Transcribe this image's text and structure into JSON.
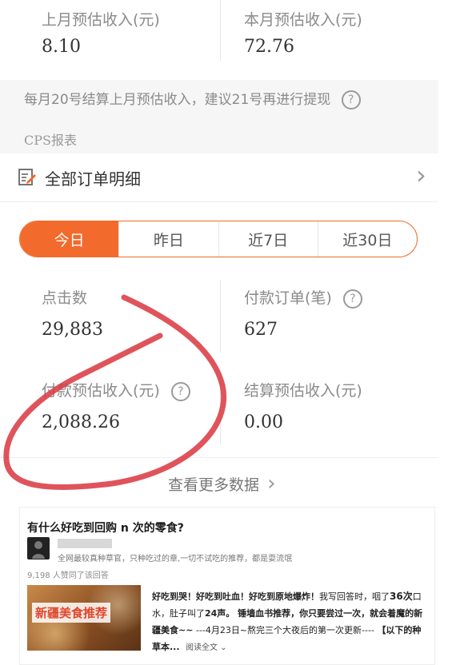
{
  "summary": {
    "last_month_label": "上月预估收入(元)",
    "last_month_value": "8.10",
    "this_month_label": "本月预估收入(元)",
    "this_month_value": "72.76"
  },
  "notice": {
    "text": "每月20号结算上月预估收入，建议21号再进行提现",
    "help_glyph": "?"
  },
  "section_title": "CPS报表",
  "orders_row": {
    "label": "全部订单明细",
    "chevron": "›"
  },
  "tabs": [
    {
      "label": "今日",
      "active": true
    },
    {
      "label": "昨日",
      "active": false
    },
    {
      "label": "近7日",
      "active": false
    },
    {
      "label": "近30日",
      "active": false
    }
  ],
  "stats": {
    "clicks_label": "点击数",
    "clicks_value": "29,883",
    "orders_label": "付款订单(笔)",
    "orders_value": "627",
    "paid_income_label": "付款预估收入(元)",
    "paid_income_value": "2,088.26",
    "settled_income_label": "结算预估收入(元)",
    "settled_income_value": "0.00",
    "help_glyph": "?"
  },
  "more_link": {
    "label": "查看更多数据",
    "arrow": "›"
  },
  "answer": {
    "question": "有什么好吃到回购 n 次的零食?",
    "author_bio": "全网最较真种草官，只种吃过的章,一切不试吃的推荐，都是耍流氓",
    "likes_text": "9,198 人赞同了该回答",
    "thumb_caption": "新疆美食推荐",
    "excerpt_bold_1": "好吃到哭！好吃到吐血！好吃到原地爆炸！",
    "excerpt_plain_1": "我写回答时，咽了",
    "excerpt_bold_2": "36次",
    "excerpt_plain_2": "口水，肚子叫了",
    "excerpt_bold_3": "24声。 锤墙血书推荐，你只要尝过一次，就会着魔的新疆美食~~",
    "excerpt_plain_3": " ---4月23日~熬完三个大夜后的第一次更新---- ",
    "excerpt_bold_4": "【以下的种草本...",
    "read_more": "阅读全文"
  },
  "colors": {
    "accent": "#f26a2c",
    "annotation": "#d9363e",
    "notice_bg": "#f6f6f6"
  }
}
